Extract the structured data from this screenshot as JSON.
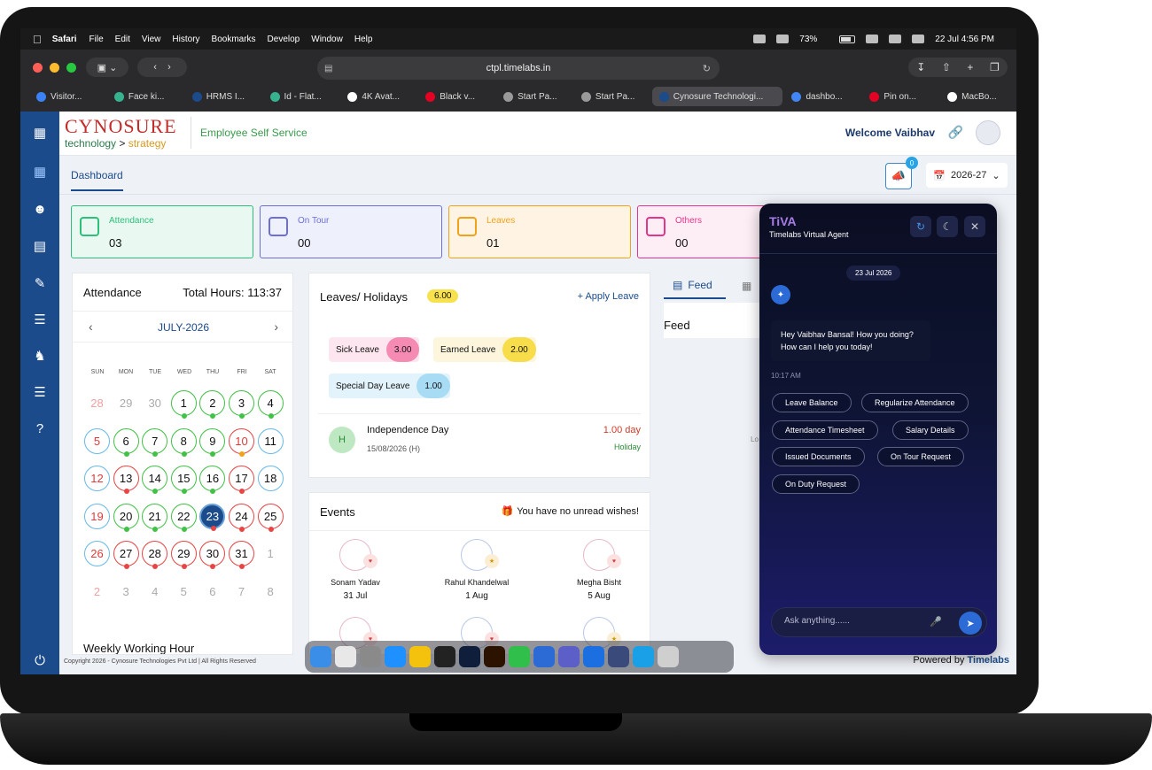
{
  "menubar": {
    "app": "Safari",
    "items": [
      "File",
      "Edit",
      "View",
      "History",
      "Bookmarks",
      "Develop",
      "Window",
      "Help"
    ],
    "battery": "73%",
    "datetime": "22 Jul  4:56 PM"
  },
  "browser": {
    "url": "ctpl.timelabs.in",
    "tabs": [
      {
        "label": "Visitor...",
        "fav": "#3b82f6"
      },
      {
        "label": "Face ki...",
        "fav": "#37b28f"
      },
      {
        "label": "HRMS I...",
        "fav": "#1b4b8a"
      },
      {
        "label": "Id - Flat...",
        "fav": "#37b28f"
      },
      {
        "label": "4K Avat...",
        "fav": "#ffffff"
      },
      {
        "label": "Black v...",
        "fav": "#e60023"
      },
      {
        "label": "Start Pa...",
        "fav": "#999999"
      },
      {
        "label": "Start Pa...",
        "fav": "#999999"
      },
      {
        "label": "Cynosure Technologi...",
        "fav": "#1b4b8a"
      },
      {
        "label": "dashbo...",
        "fav": "#4285f4"
      },
      {
        "label": "Pin on...",
        "fav": "#e60023"
      },
      {
        "label": "MacBo...",
        "fav": "#ffffff"
      }
    ]
  },
  "header": {
    "logo_top": "CYNOSURE",
    "logo_tech": "technology",
    "logo_arrow": ">",
    "logo_strategy": "strategy",
    "portal": "Employee Self Service",
    "welcome": "Welcome Vaibhav"
  },
  "subbar": {
    "tab": "Dashboard",
    "notif_count": "0",
    "year": "2026-27"
  },
  "stats": [
    {
      "label": "Attendance",
      "value": "03",
      "color": "#2fbf7a",
      "bg": "#e9f8f1"
    },
    {
      "label": "On Tour",
      "value": "00",
      "color": "#6e6fd6",
      "bg": "#eef0fb"
    },
    {
      "label": "Leaves",
      "value": "01",
      "color": "#f0a21a",
      "bg": "#fff4e3"
    },
    {
      "label": "Others",
      "value": "00",
      "color": "#e2358c",
      "bg": "#fdeef5"
    }
  ],
  "attendance": {
    "title": "Attendance",
    "total_hours": "Total Hours: 113:37",
    "month": "JULY-2026",
    "dow": [
      "SUN",
      "MON",
      "TUE",
      "WED",
      "THU",
      "FRI",
      "SAT"
    ],
    "weekly_title": "Weekly Working Hour",
    "days": [
      {
        "d": "28",
        "s": "pk"
      },
      {
        "d": "29",
        "s": "dim"
      },
      {
        "d": "30",
        "s": "dim"
      },
      {
        "d": "1",
        "s": "g"
      },
      {
        "d": "2",
        "s": "g"
      },
      {
        "d": "3",
        "s": "g"
      },
      {
        "d": "4",
        "s": "g"
      },
      {
        "d": "5",
        "s": "bw"
      },
      {
        "d": "6",
        "s": "g"
      },
      {
        "d": "7",
        "s": "g"
      },
      {
        "d": "8",
        "s": "g"
      },
      {
        "d": "9",
        "s": "g"
      },
      {
        "d": "10",
        "s": "ro"
      },
      {
        "d": "11",
        "s": "b"
      },
      {
        "d": "12",
        "s": "bw"
      },
      {
        "d": "13",
        "s": "r"
      },
      {
        "d": "14",
        "s": "g"
      },
      {
        "d": "15",
        "s": "g"
      },
      {
        "d": "16",
        "s": "g"
      },
      {
        "d": "17",
        "s": "r"
      },
      {
        "d": "18",
        "s": "b"
      },
      {
        "d": "19",
        "s": "bw"
      },
      {
        "d": "20",
        "s": "g"
      },
      {
        "d": "21",
        "s": "g"
      },
      {
        "d": "22",
        "s": "g"
      },
      {
        "d": "23",
        "s": "today"
      },
      {
        "d": "24",
        "s": "r"
      },
      {
        "d": "25",
        "s": "r"
      },
      {
        "d": "26",
        "s": "bw"
      },
      {
        "d": "27",
        "s": "r"
      },
      {
        "d": "28",
        "s": "r"
      },
      {
        "d": "29",
        "s": "r"
      },
      {
        "d": "30",
        "s": "r"
      },
      {
        "d": "31",
        "s": "r"
      },
      {
        "d": "1",
        "s": "dim"
      },
      {
        "d": "2",
        "s": "pk"
      },
      {
        "d": "3",
        "s": "dim"
      },
      {
        "d": "4",
        "s": "dim"
      },
      {
        "d": "5",
        "s": "dim"
      },
      {
        "d": "6",
        "s": "dim"
      },
      {
        "d": "7",
        "s": "dim"
      },
      {
        "d": "8",
        "s": "dim"
      }
    ]
  },
  "leaves": {
    "title": "Leaves/ Holidays",
    "total": "6.00",
    "apply": "+ Apply Leave",
    "chips": [
      {
        "label": "Sick Leave",
        "value": "3.00",
        "bg": "#fde6ef",
        "vbg": "#f58bb2"
      },
      {
        "label": "Earned Leave",
        "value": "2.00",
        "bg": "#fdf6dc",
        "vbg": "#f7dd4a"
      },
      {
        "label": "Special Day Leave",
        "value": "1.00",
        "bg": "#e3f3fb",
        "vbg": "#a8dcf4"
      }
    ],
    "holiday": {
      "initial": "H",
      "name": "Independence Day",
      "date": "15/08/2026 (H)",
      "days": "1.00 day",
      "tag": "Holiday"
    }
  },
  "events": {
    "title": "Events",
    "wishes": "You have no unread wishes!",
    "people": [
      {
        "name": "Sonam Yadav",
        "date": "31 Jul"
      },
      {
        "name": "Rahul Khandelwal",
        "date": "1 Aug"
      },
      {
        "name": "Megha Bisht",
        "date": "5 Aug"
      }
    ]
  },
  "feed": {
    "tab": "Feed",
    "heading": "Feed",
    "loading": "Lo"
  },
  "footer": {
    "copyright": "Copyright 2026 - Cynosure Technologies Pvt Ltd | All Rights Reserved",
    "powered": "Powered by",
    "brand": "Timelabs"
  },
  "chat": {
    "title": "TiVA",
    "subtitle": "Timelabs Virtual Agent",
    "date": "23 Jul 2026",
    "message": "Hey Vaibhav Bansal! How you doing? How can I help you today!",
    "time": "10:17 AM",
    "quick": [
      "Leave Balance",
      "Regularize Attendance",
      "Attendance Timesheet",
      "Salary Details",
      "Issued Documents",
      "On Tour Request",
      "On Duty Request"
    ],
    "placeholder": "Ask anything......"
  }
}
